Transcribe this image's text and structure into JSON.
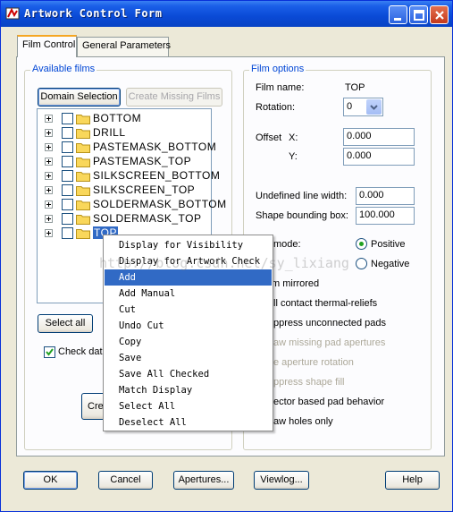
{
  "window": {
    "title": "Artwork Control Form"
  },
  "tabs": [
    {
      "label": "Film Control",
      "active": true
    },
    {
      "label": "General Parameters",
      "active": false
    }
  ],
  "available_films": {
    "title": "Available films",
    "domain_selection": "Domain Selection",
    "create_missing": "Create Missing Films",
    "films": [
      "BOTTOM",
      "DRILL",
      "PASTEMASK_BOTTOM",
      "PASTEMASK_TOP",
      "SILKSCREEN_BOTTOM",
      "SILKSCREEN_TOP",
      "SOLDERMASK_BOTTOM",
      "SOLDERMASK_TOP",
      "TOP"
    ],
    "selected_film": "TOP",
    "select_all": "Select all",
    "check_label_partial": "Check dat",
    "create_partial": "Cre"
  },
  "film_options": {
    "title": "Film options",
    "film_name_label": "Film name:",
    "film_name_value": "TOP",
    "rotation_label": "Rotation:",
    "rotation_value": "0",
    "offset_label": "Offset",
    "x_label": "X:",
    "x_value": "0.000",
    "y_label": "Y:",
    "y_value": "0.000",
    "undefined_line_width_label": "Undefined line width:",
    "undefined_line_width_value": "0.000",
    "shape_bounding_box_label": "Shape bounding box:",
    "shape_bounding_box_value": "100.000",
    "mode_label_partial": "mode:",
    "positive": "Positive",
    "negative": "Negative",
    "options_partial": [
      "m mirrored",
      "ll contact thermal-reliefs",
      "ppress unconnected pads",
      "aw missing pad apertures",
      "e aperture rotation",
      "ppress shape fill",
      "ector based pad behavior",
      "aw holes only"
    ]
  },
  "context_menu": {
    "items": [
      "Display for Visibility",
      "Display for Artwork Check",
      "Add",
      "Add Manual",
      "Cut",
      "Undo Cut",
      "Copy",
      "Save",
      "Save All Checked",
      "Match Display",
      "Select All",
      "Deselect All"
    ],
    "highlighted": "Add"
  },
  "watermark": "http://blog.csdn.net/sy_lixiang",
  "footer": {
    "ok": "OK",
    "cancel": "Cancel",
    "apertures": "Apertures...",
    "viewlog": "Viewlog...",
    "help": "Help"
  },
  "colors": {
    "titlebar": "#0a4ad6",
    "selection": "#316ac5",
    "group_title": "#0046d5",
    "radio_dot": "#21a121"
  }
}
